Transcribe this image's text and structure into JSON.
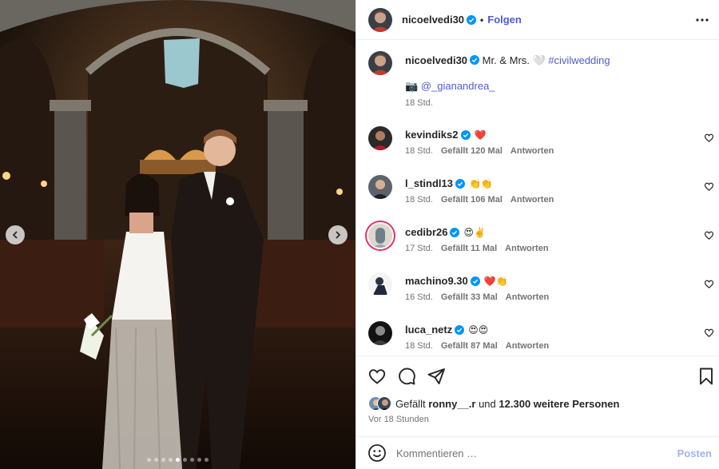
{
  "header": {
    "username": "nicoelvedi30",
    "separator": "•",
    "follow_label": "Folgen",
    "more_icon": "more-horizontal-icon"
  },
  "caption": {
    "username": "nicoelvedi30",
    "text": "Mr. & Mrs. 🤍",
    "hashtag": "#civilwedding",
    "camera_emoji": "📷",
    "mention": "@_gianandrea_",
    "time": "18 Std."
  },
  "comments": [
    {
      "username": "kevindiks2",
      "emoji": "❤️",
      "time": "18 Std.",
      "likes": "Gefällt 120 Mal",
      "reply": "Antworten"
    },
    {
      "username": "l_stindl13",
      "emoji": "👏👏",
      "time": "18 Std.",
      "likes": "Gefällt 106 Mal",
      "reply": "Antworten"
    },
    {
      "username": "cedibr26",
      "emoji": "😍✌️",
      "time": "17 Std.",
      "likes": "Gefällt 11 Mal",
      "reply": "Antworten"
    },
    {
      "username": "machino9.30",
      "emoji": "❤️👏",
      "time": "16 Std.",
      "likes": "Gefällt 33 Mal",
      "reply": "Antworten"
    },
    {
      "username": "luca_netz",
      "emoji": "😍😍",
      "time": "18 Std.",
      "likes": "Gefällt 87 Mal",
      "reply": "Antworten"
    }
  ],
  "likes": {
    "prefix": "Gefällt",
    "user": "ronny__.r",
    "middle": "und",
    "others": "12.300 weitere Personen"
  },
  "posted_ago": "Vor 18 Stunden",
  "composer": {
    "placeholder": "Kommentieren …",
    "post_label": "Posten"
  },
  "carousel": {
    "count": 9,
    "active_index": 4
  },
  "colors": {
    "link": "#4f5bd5",
    "verified": "#0095f6",
    "muted": "#737373",
    "post_disabled": "#9fb4ea"
  }
}
